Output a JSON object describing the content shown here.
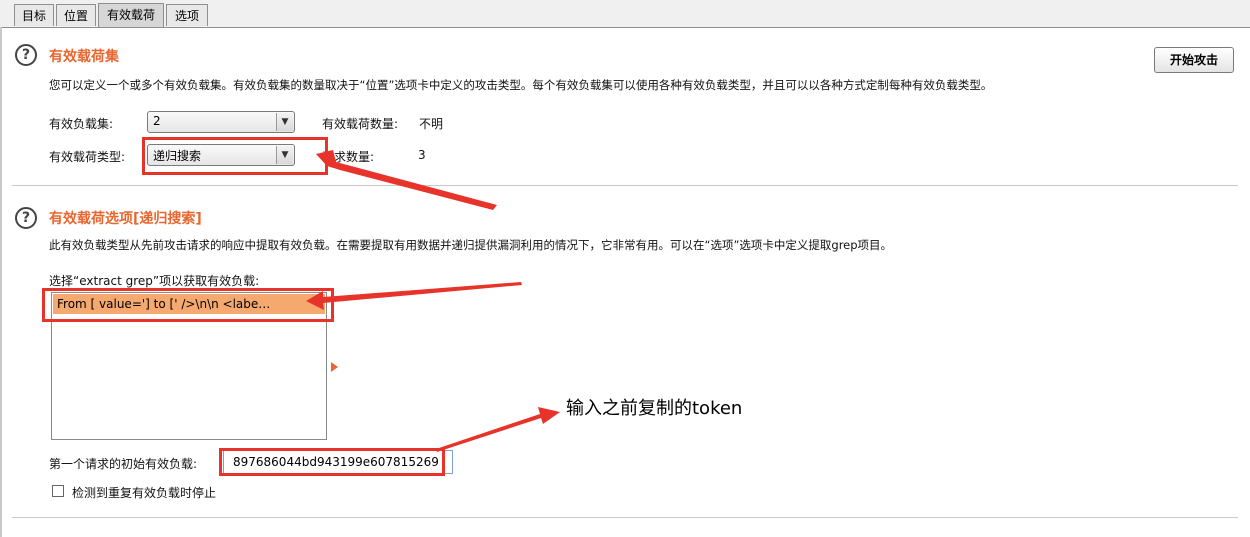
{
  "tabs": [
    {
      "label": "目标"
    },
    {
      "label": "位置"
    },
    {
      "label": "有效载荷",
      "active": true
    },
    {
      "label": "选项"
    }
  ],
  "payload_sets": {
    "title": "有效载荷集",
    "description": "您可以定义一个或多个有效负载集。有效负载集的数量取决于“位置”选项卡中定义的攻击类型。每个有效负载集可以使用各种有效负载类型，并且可以以各种方式定制每种有效负载类型。",
    "start_attack_label": "开始攻击",
    "set_label": "有效负载集:",
    "set_value": "2",
    "count_label": "有效载荷数量:",
    "count_value": "不明",
    "type_label": "有效载荷类型:",
    "type_value": "递归搜索",
    "request_count_label": "请求数量:",
    "request_count_value": "3"
  },
  "payload_options": {
    "title": "有效载荷选项[递归搜索]",
    "description": "此有效负载类型从先前攻击请求的响应中提取有效负载。在需要提取有用数据并递归提供漏洞利用的情况下，它非常有用。可以在“选项”选项卡中定义提取grep项目。",
    "grep_label": "选择“extract grep”项以获取有效负载:",
    "grep_items": [
      "From [ value='] to [' />\\n\\n                <labe…"
    ],
    "initial_payload_label": "第一个请求的初始有效负载:",
    "initial_payload_value": "897686044bd943199e607815269",
    "stop_checkbox_label": "检测到重复有效负载时停止",
    "stop_checked": false
  },
  "annotation": {
    "text": "输入之前复制的token",
    "color": "#e8332b"
  },
  "colors": {
    "accent": "#e8662f",
    "highlight_row": "#f5a96f",
    "annotation_red": "#e8332b"
  }
}
